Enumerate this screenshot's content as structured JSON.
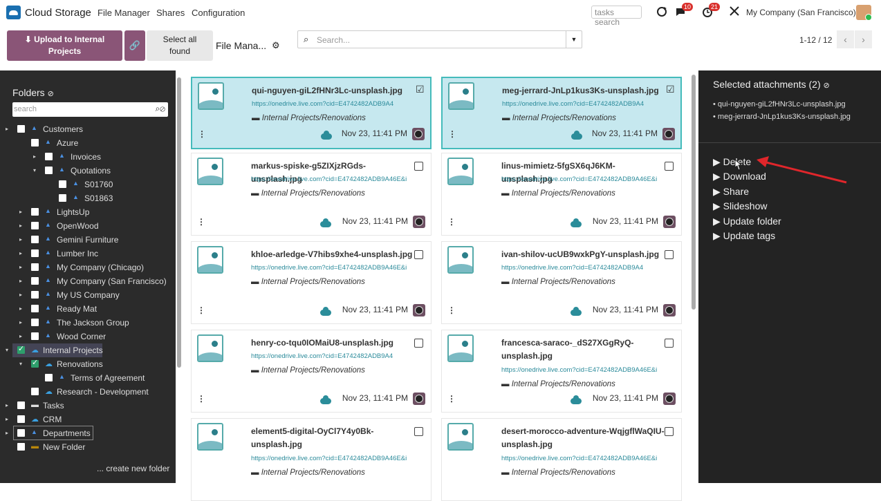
{
  "topbar": {
    "brand": "Cloud Storage",
    "nav": [
      "File Manager",
      "Shares",
      "Configuration"
    ],
    "tasks_search": "tasks search",
    "chat_badge": "10",
    "activity_badge": "21",
    "company": "My Company (San Francisco)"
  },
  "controls": {
    "upload_line1": "⬇ Upload to Internal",
    "upload_line2": "Projects",
    "select_line1": "Select all",
    "select_line2": "found",
    "title": "File Mana...",
    "search_placeholder": "Search...",
    "pager": "1-12 / 12"
  },
  "sidebar": {
    "heading": "Folders",
    "search_placeholder": "search",
    "create_folder": "... create new folder",
    "tree": [
      {
        "label": "Customers",
        "checked": false
      },
      {
        "label": "Azure",
        "checked": false
      },
      {
        "label": "Invoices",
        "checked": false
      },
      {
        "label": "Quotations",
        "checked": false
      },
      {
        "label": "S01760",
        "checked": false
      },
      {
        "label": "S01863",
        "checked": false
      },
      {
        "label": "LightsUp",
        "checked": false
      },
      {
        "label": "OpenWood",
        "checked": false
      },
      {
        "label": "Gemini Furniture",
        "checked": false
      },
      {
        "label": "Lumber Inc",
        "checked": false
      },
      {
        "label": "My Company (Chicago)",
        "checked": false
      },
      {
        "label": "My Company (San Francisco)",
        "checked": false
      },
      {
        "label": "My US Company",
        "checked": false
      },
      {
        "label": "Ready Mat",
        "checked": false
      },
      {
        "label": "The Jackson Group",
        "checked": false
      },
      {
        "label": "Wood Corner",
        "checked": false
      },
      {
        "label": "Internal Projects",
        "checked": true
      },
      {
        "label": "Renovations",
        "checked": true
      },
      {
        "label": "Terms of Agreement",
        "checked": false
      },
      {
        "label": "Research - Development",
        "checked": false
      },
      {
        "label": "Tasks",
        "checked": false
      },
      {
        "label": "CRM",
        "checked": false
      },
      {
        "label": "Departments",
        "checked": false
      },
      {
        "label": "New Folder",
        "checked": false
      }
    ]
  },
  "files": [
    {
      "name": "qui-nguyen-giL2fHNr3Lc-unsplash.jpg",
      "url": "https://onedrive.live.com?cid=E4742482ADB9A4",
      "path": "Internal Projects/Renovations",
      "date": "Nov 23, 11:41 PM",
      "selected": true
    },
    {
      "name": "meg-jerrard-JnLp1kus3Ks-unsplash.jpg",
      "url": "https://onedrive.live.com?cid=E4742482ADB9A4",
      "path": "Internal Projects/Renovations",
      "date": "Nov 23, 11:41 PM",
      "selected": true
    },
    {
      "name": "markus-spiske-g5ZIXjzRGds-unsplash.jpg",
      "url": "https://onedrive.live.com?cid=E4742482ADB9A46E&i",
      "path": "Internal Projects/Renovations",
      "date": "Nov 23, 11:41 PM",
      "selected": false
    },
    {
      "name": "linus-mimietz-5fgSX6qJ6KM-unsplash.jpg",
      "url": "https://onedrive.live.com?cid=E4742482ADB9A46E&i",
      "path": "Internal Projects/Renovations",
      "date": "Nov 23, 11:41 PM",
      "selected": false
    },
    {
      "name": "khloe-arledge-V7hibs9xhe4-unsplash.jpg",
      "url": "https://onedrive.live.com?cid=E4742482ADB9A46E&i",
      "path": "Internal Projects/Renovations",
      "date": "Nov 23, 11:41 PM",
      "selected": false
    },
    {
      "name": "ivan-shilov-ucUB9wxkPgY-unsplash.jpg",
      "url": "https://onedrive.live.com?cid=E4742482ADB9A4",
      "path": "Internal Projects/Renovations",
      "date": "Nov 23, 11:41 PM",
      "selected": false
    },
    {
      "name": "henry-co-tqu0IOMaiU8-unsplash.jpg",
      "url": "https://onedrive.live.com?cid=E4742482ADB9A4",
      "path": "Internal Projects/Renovations",
      "date": "Nov 23, 11:41 PM",
      "selected": false
    },
    {
      "name": "francesca-saraco-_dS27XGgRyQ-unsplash.jpg",
      "url": "https://onedrive.live.com?cid=E4742482ADB9A46E&i",
      "path": "Internal Projects/Renovations",
      "date": "Nov 23, 11:41 PM",
      "selected": false
    },
    {
      "name": "element5-digital-OyCl7Y4y0Bk-unsplash.jpg",
      "url": "https://onedrive.live.com?cid=E4742482ADB9A46E&i",
      "path": "Internal Projects/Renovations",
      "date": "",
      "selected": false
    },
    {
      "name": "desert-morocco-adventure-WqjgflWaQIU-unsplash.jpg",
      "url": "https://onedrive.live.com?cid=E4742482ADB9A46E&i",
      "path": "Internal Projects/Renovations",
      "date": "",
      "selected": false
    }
  ],
  "right_panel": {
    "title": "Selected attachments (2)",
    "items": [
      "qui-nguyen-giL2fHNr3Lc-unsplash.jpg",
      "meg-jerrard-JnLp1kus3Ks-unsplash.jpg"
    ],
    "actions": [
      "Delete",
      "Download",
      "Share",
      "Slideshow",
      "Update folder",
      "Update tags"
    ]
  },
  "colors": {
    "accent": "#8a5577",
    "teal": "#2a8a9a",
    "selected_card": "#c6e8ef",
    "annotation_arrow": "#e0262b"
  }
}
